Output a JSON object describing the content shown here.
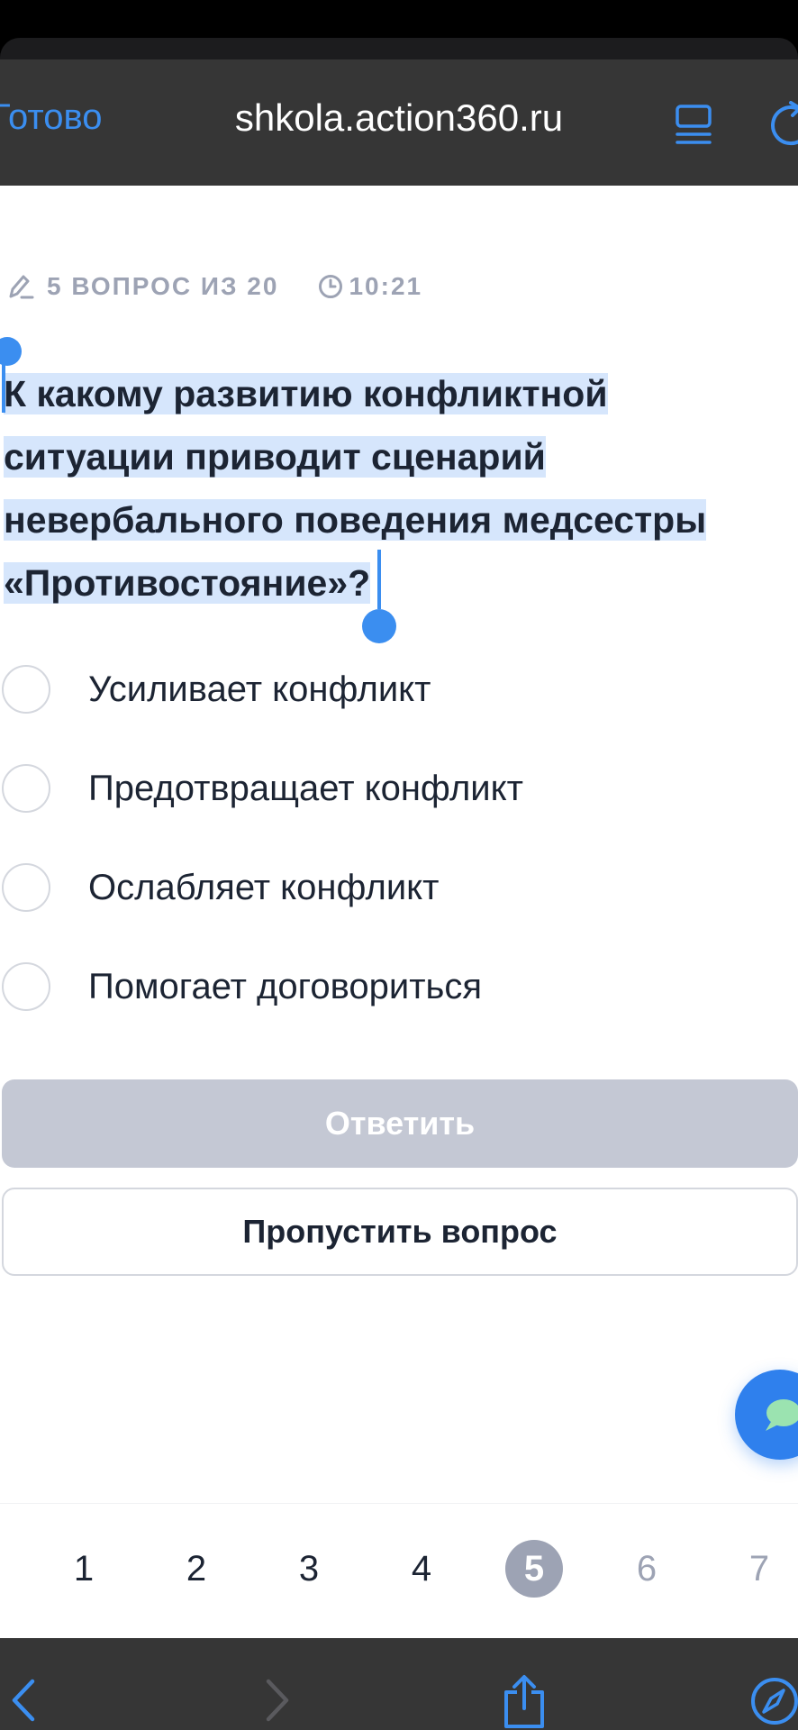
{
  "browser": {
    "done_label": "Готово",
    "url": "shkola.action360.ru"
  },
  "quiz": {
    "progress_text": "5 ВОПРОС ИЗ 20",
    "timer": "10:21",
    "question_lines": [
      "К какому развитию конфликтной",
      "ситуации приводит сценарий",
      "невербального поведения медсестры",
      "«Противостояние»?"
    ],
    "options": [
      "Усиливает конфликт",
      "Предотвращает конфликт",
      "Ослабляет конфликт",
      "Помогает договориться"
    ],
    "answer_label": "Ответить",
    "skip_label": "Пропустить вопрос"
  },
  "pagination": {
    "pages": [
      "1",
      "2",
      "3",
      "4",
      "5",
      "6",
      "7"
    ],
    "current": "5"
  },
  "colors": {
    "accent": "#3b8ef0",
    "selection": "#d6e6fc",
    "muted": "#9da3b4",
    "disabled_button": "#c4c8d4",
    "chat_button": "#2f80ed",
    "chrome": "#363636"
  }
}
